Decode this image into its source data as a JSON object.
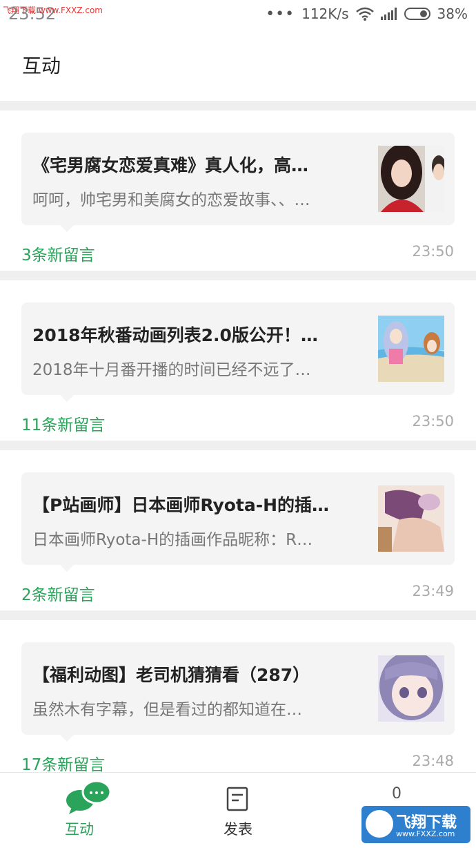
{
  "status_bar": {
    "watermark": "飞翔下载 www.FXXZ.com",
    "time": "23:52",
    "network_speed": "112K/s",
    "battery": "38%"
  },
  "header": {
    "title": "互动"
  },
  "cards": [
    {
      "title": "《宅男腐女恋爱真难》真人化，高…",
      "subtitle": "呵呵，帅宅男和美腐女的恋爱故事、、…",
      "count": "3条新留言",
      "time": "23:50"
    },
    {
      "title": "2018年秋番动画列表2.0版公开！…",
      "subtitle": "2018年十月番开播的时间已经不远了…",
      "count": "11条新留言",
      "time": "23:50"
    },
    {
      "title": "【P站画师】日本画师Ryota-H的插…",
      "subtitle": "日本画师Ryota-H的插画作品昵称：R…",
      "count": "2条新留言",
      "time": "23:49"
    },
    {
      "title": "【福利动图】老司机猜猜看（287）",
      "subtitle": "虽然木有字幕，但是看过的都知道在…",
      "count": "17条新留言",
      "time": "23:48"
    }
  ],
  "tabbar": {
    "tab1_label": "互动",
    "tab2_label": "发表",
    "tab3_badge": "0",
    "accent": "#2aa45a"
  },
  "watermark_logo": {
    "text": "飞翔下载",
    "sub": "www.FXXZ.com"
  }
}
